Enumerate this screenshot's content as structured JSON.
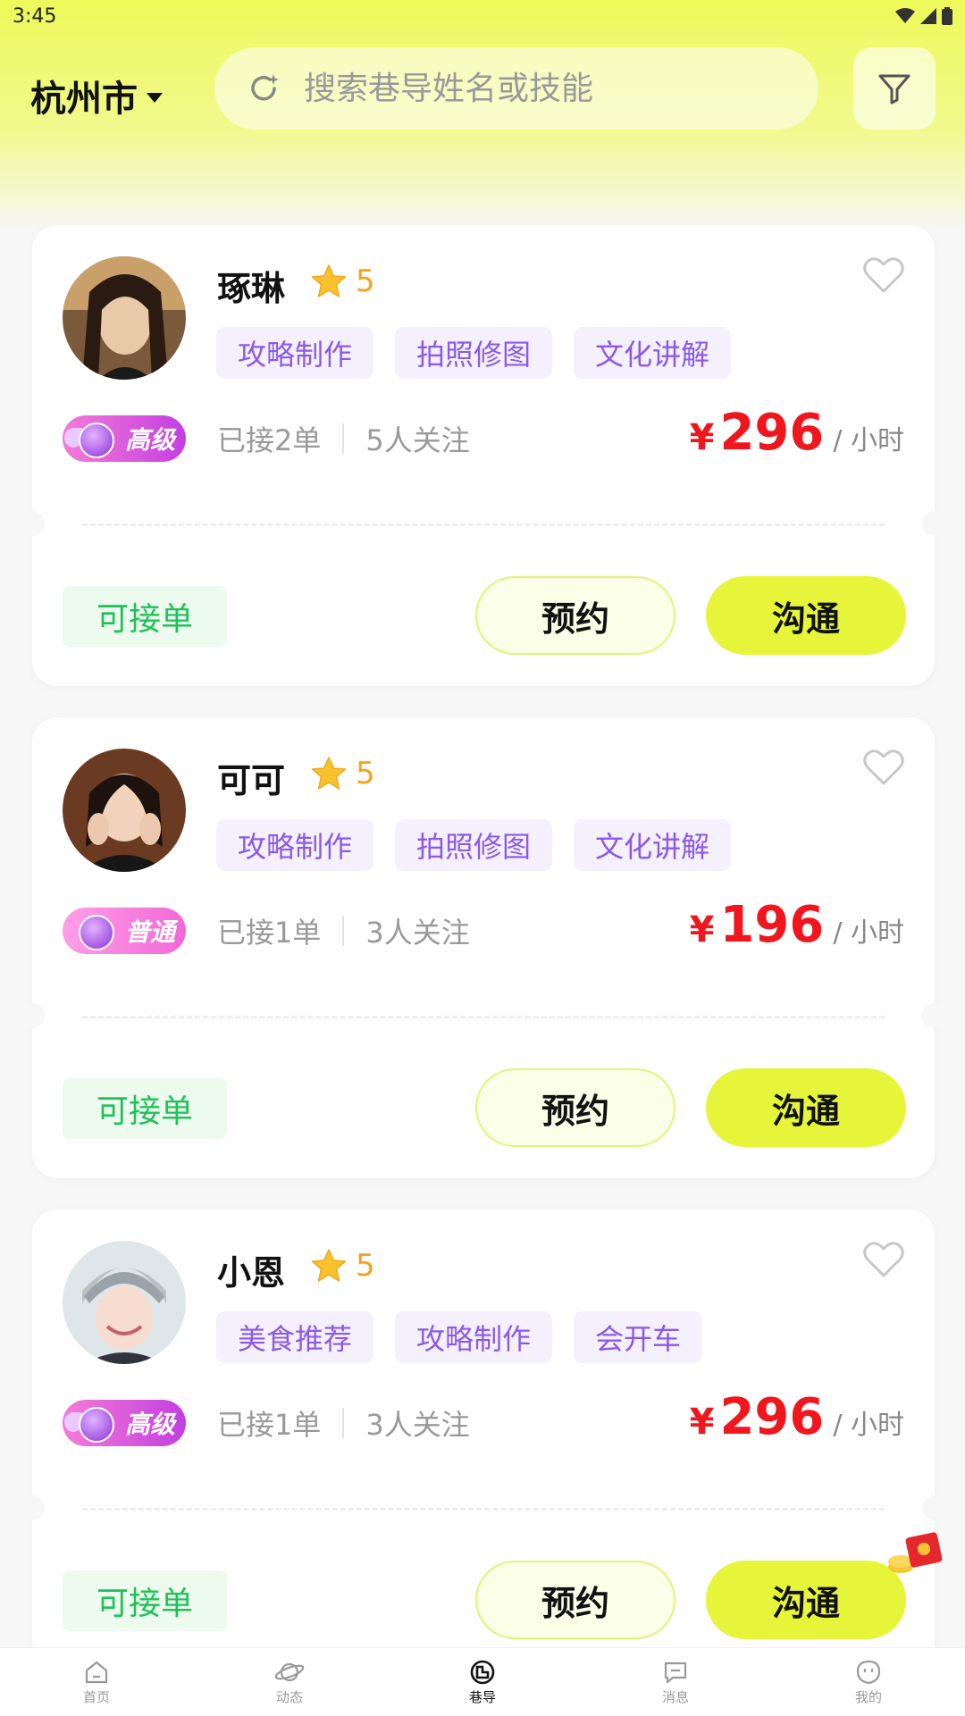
{
  "status": {
    "time": "3:45"
  },
  "header": {
    "city": "杭州市",
    "search_placeholder": "搜索巷导姓名或技能"
  },
  "guides": [
    {
      "name": "琢琳",
      "rating": "5",
      "tags": [
        "攻略制作",
        "拍照修图",
        "文化讲解"
      ],
      "level": "高级",
      "orders": "已接2单",
      "followers": "5人关注",
      "currency": "¥",
      "price": "296",
      "unit": "/ 小时",
      "availability": "可接单",
      "book_label": "预约",
      "chat_label": "沟通"
    },
    {
      "name": "可可",
      "rating": "5",
      "tags": [
        "攻略制作",
        "拍照修图",
        "文化讲解"
      ],
      "level": "普通",
      "orders": "已接1单",
      "followers": "3人关注",
      "currency": "¥",
      "price": "196",
      "unit": "/ 小时",
      "availability": "可接单",
      "book_label": "预约",
      "chat_label": "沟通"
    },
    {
      "name": "小恩",
      "rating": "5",
      "tags": [
        "美食推荐",
        "攻略制作",
        "会开车"
      ],
      "level": "高级",
      "orders": "已接1单",
      "followers": "3人关注",
      "currency": "¥",
      "price": "296",
      "unit": "/ 小时",
      "availability": "可接单",
      "book_label": "预约",
      "chat_label": "沟通"
    }
  ],
  "tabbar": {
    "items": [
      {
        "label": "首页",
        "icon": "home-icon"
      },
      {
        "label": "动态",
        "icon": "planet-icon"
      },
      {
        "label": "巷导",
        "icon": "guide-icon"
      },
      {
        "label": "消息",
        "icon": "message-icon"
      },
      {
        "label": "我的",
        "icon": "profile-icon"
      }
    ],
    "active": "巷导"
  },
  "colors": {
    "accent": "#e6f53a",
    "price": "#f0161d",
    "tag_text": "#8a5ae6",
    "available": "#22c05a",
    "star": "#f6a21a"
  }
}
